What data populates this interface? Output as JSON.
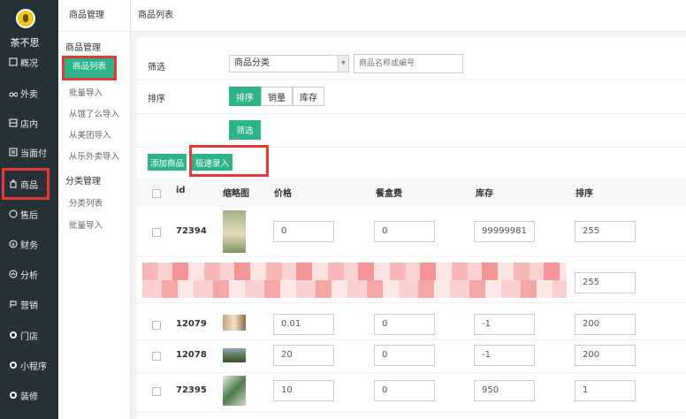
{
  "brand": {
    "name": "茶不思"
  },
  "nav": [
    {
      "label": "概况",
      "icon": "overview-icon"
    },
    {
      "label": "外卖",
      "icon": "delivery-icon"
    },
    {
      "label": "店内",
      "icon": "store-icon"
    },
    {
      "label": "当面付",
      "icon": "pay-icon"
    },
    {
      "label": "商品",
      "icon": "goods-icon"
    },
    {
      "label": "售后",
      "icon": "after-sale-icon"
    },
    {
      "label": "财务",
      "icon": "finance-icon"
    },
    {
      "label": "分析",
      "icon": "analytics-icon"
    },
    {
      "label": "营销",
      "icon": "marketing-icon"
    },
    {
      "label": "门店",
      "icon": "shop-icon"
    },
    {
      "label": "小程序",
      "icon": "miniapp-icon"
    },
    {
      "label": "装修",
      "icon": "decorate-icon"
    }
  ],
  "subnav": {
    "header": "商品管理",
    "group1": "商品管理",
    "items1": [
      "商品列表",
      "批量导入",
      "从饿了么导入",
      "从美团导入",
      "从乐外卖导入"
    ],
    "group2": "分类管理",
    "items2": [
      "分类列表",
      "批量导入"
    ]
  },
  "page_title": "商品列表",
  "filter": {
    "label": "筛选",
    "category_select": "商品分类",
    "search_placeholder": "商品名称或编号"
  },
  "sort": {
    "label": "排序",
    "options": [
      "排序",
      "销量",
      "库存"
    ],
    "selected": "排序"
  },
  "buttons": {
    "filter": "筛选",
    "add": "添加商品",
    "quick": "极速录入"
  },
  "table": {
    "headers": [
      "id",
      "缩略图",
      "价格",
      "餐盒费",
      "库存",
      "排序"
    ],
    "rows": [
      {
        "id": "72394",
        "price": "0",
        "box_fee": "0",
        "stock": "99999981",
        "sort": "255"
      },
      {
        "id": "",
        "price": "",
        "box_fee": "",
        "stock": "",
        "sort": "255"
      },
      {
        "id": "12079",
        "price": "0.01",
        "box_fee": "0",
        "stock": "-1",
        "sort": "200"
      },
      {
        "id": "12078",
        "price": "20",
        "box_fee": "0",
        "stock": "-1",
        "sort": "200"
      },
      {
        "id": "72395",
        "price": "10",
        "box_fee": "0",
        "stock": "950",
        "sort": "1"
      }
    ]
  }
}
